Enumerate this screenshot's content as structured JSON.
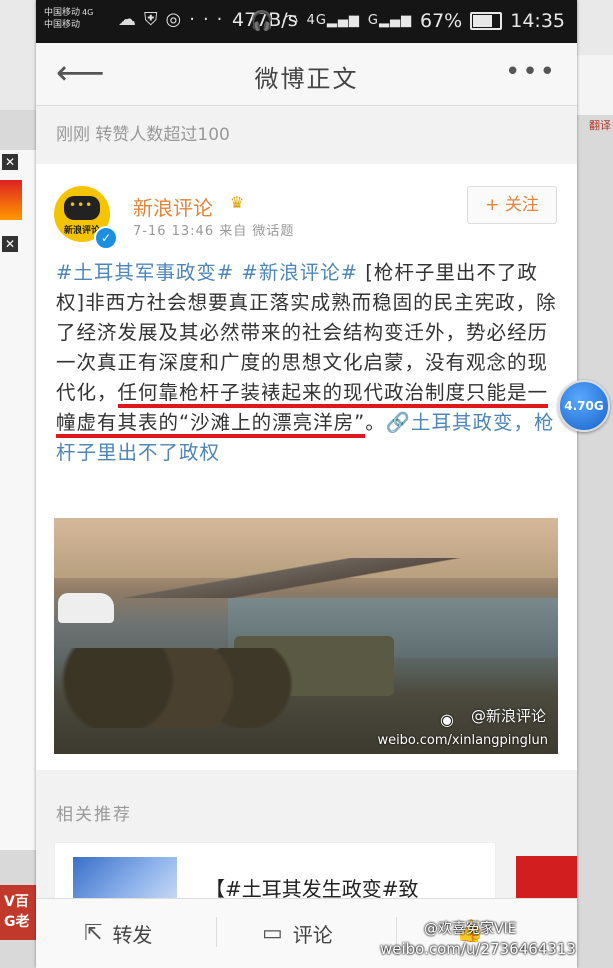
{
  "status_bar": {
    "carrier1": "中国移动",
    "carrier1_net": "4G",
    "carrier2": "中国移动",
    "net_speed": "477B/s",
    "signal1": "4G",
    "signal2": "G",
    "battery": "67%",
    "time": "14:35"
  },
  "nav": {
    "title": "微博正文"
  },
  "repost_info": "刚刚  转赞人数超过100",
  "post": {
    "author": "新浪评论",
    "avatar_text": "新浪评论",
    "meta": "7-16 13:46  来自 微话题",
    "follow_label": "+ 关注",
    "topic1": "#土耳其军事政变#",
    "topic2": "#新浪评论#",
    "text_title": "[枪杆子里出不了政权]",
    "text_body": "非西方社会想要真正落实成熟而稳固的民主宪政，除了经济发展及其必然带来的社会结构变迁外，势必经历一次真正有深度和广度的思想文化启蒙，没有观念的现代化，",
    "text_highlight": "任何靠枪杆子装裱起来的现代政治制度只能是一幢虚有其表的“沙滩上的漂亮洋房”",
    "text_end": "。",
    "link_text": "🔗土耳其政变，枪杆子里出不了政权",
    "image_watermark_name": "@新浪评论",
    "image_watermark_url": "weibo.com/xinlangpinglun"
  },
  "recommend": {
    "title": "相关推荐",
    "item_text": "【#土耳其发生政变#致"
  },
  "bottom_bar": {
    "repost_label": "转发",
    "comment_label": "评论"
  },
  "float_badge": "4.70G",
  "watermark": {
    "name": "@欢喜冤家VIE",
    "url": "weibo.com/u/2736464313"
  },
  "background": {
    "right_text": "翻译",
    "bottom_left_text": "V百\nG老"
  },
  "colors": {
    "accent_orange": "#e0853b",
    "link_blue": "#4e86b8",
    "highlight_red": "#e0181e"
  }
}
